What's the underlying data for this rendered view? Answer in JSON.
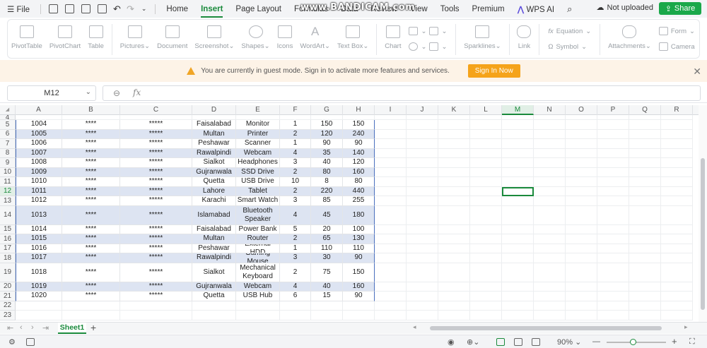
{
  "menubar": {
    "file_label": "File",
    "tabs": [
      "Home",
      "Insert",
      "Page Layout",
      "Formulas",
      "Data",
      "Review",
      "View",
      "Tools",
      "Premium"
    ],
    "active_tab": "Insert",
    "wps_ai_label": "WPS AI",
    "cloud_status": "Not uploaded",
    "share_label": "Share",
    "watermark": "www.BANDICAM.com"
  },
  "ribbon": {
    "buttons": {
      "pivottable": "PivotTable",
      "pivotchart": "PivotChart",
      "table": "Table",
      "pictures": "Pictures",
      "document": "Document",
      "screenshot": "Screenshot",
      "shapes": "Shapes",
      "icons": "Icons",
      "wordart": "WordArt",
      "textbox": "Text Box",
      "chart": "Chart",
      "sparklines": "Sparklines",
      "link": "Link",
      "equation": "Equation",
      "symbol": "Symbol",
      "attachments": "Attachments",
      "form": "Form",
      "camera": "Camera"
    }
  },
  "banner": {
    "message": "You are currently in guest mode. Sign in to activate more features and services.",
    "signin_label": "Sign In Now"
  },
  "formula_bar": {
    "name_box": "M12",
    "fx_label": "fx",
    "formula": ""
  },
  "columns": [
    "A",
    "B",
    "C",
    "D",
    "E",
    "F",
    "G",
    "H",
    "I",
    "J",
    "K",
    "L",
    "M",
    "N",
    "O",
    "P",
    "Q",
    "R"
  ],
  "selected_column": "M",
  "rows": [
    {
      "num": "4",
      "cells": [
        "",
        "",
        "",
        "",
        "",
        "",
        "",
        ""
      ]
    },
    {
      "num": "5",
      "cells": [
        "1004",
        "****",
        "*****",
        "Faisalabad",
        "Monitor",
        "1",
        "150",
        "150"
      ]
    },
    {
      "num": "6",
      "cells": [
        "1005",
        "****",
        "*****",
        "Multan",
        "Printer",
        "2",
        "120",
        "240"
      ]
    },
    {
      "num": "7",
      "cells": [
        "1006",
        "****",
        "*****",
        "Peshawar",
        "Scanner",
        "1",
        "90",
        "90"
      ]
    },
    {
      "num": "8",
      "cells": [
        "1007",
        "****",
        "*****",
        "Rawalpindi",
        "Webcam",
        "4",
        "35",
        "140"
      ]
    },
    {
      "num": "9",
      "cells": [
        "1008",
        "****",
        "*****",
        "Sialkot",
        "Headphones",
        "3",
        "40",
        "120"
      ]
    },
    {
      "num": "10",
      "cells": [
        "1009",
        "****",
        "*****",
        "Gujranwala",
        "SSD Drive",
        "2",
        "80",
        "160"
      ]
    },
    {
      "num": "11",
      "cells": [
        "1010",
        "****",
        "*****",
        "Quetta",
        "USB Drive",
        "10",
        "8",
        "80"
      ]
    },
    {
      "num": "12",
      "cells": [
        "1011",
        "****",
        "*****",
        "Lahore",
        "Tablet",
        "2",
        "220",
        "440"
      ]
    },
    {
      "num": "13",
      "cells": [
        "1012",
        "****",
        "*****",
        "Karachi",
        "Smart Watch",
        "3",
        "85",
        "255"
      ]
    },
    {
      "num": "14",
      "cells": [
        "1013",
        "****",
        "*****",
        "Islamabad",
        "Bluetooth Speaker",
        "4",
        "45",
        "180"
      ]
    },
    {
      "num": "15",
      "cells": [
        "1014",
        "****",
        "*****",
        "Faisalabad",
        "Power Bank",
        "5",
        "20",
        "100"
      ]
    },
    {
      "num": "16",
      "cells": [
        "1015",
        "****",
        "*****",
        "Multan",
        "Router",
        "2",
        "65",
        "130"
      ]
    },
    {
      "num": "17",
      "cells": [
        "1016",
        "****",
        "*****",
        "Peshawar",
        "External HDD",
        "1",
        "110",
        "110"
      ]
    },
    {
      "num": "18",
      "cells": [
        "1017",
        "****",
        "*****",
        "Rawalpindi",
        "Gaming Mouse",
        "3",
        "30",
        "90"
      ]
    },
    {
      "num": "19",
      "cells": [
        "1018",
        "****",
        "*****",
        "Sialkot",
        "Mechanical Keyboard",
        "2",
        "75",
        "150"
      ]
    },
    {
      "num": "20",
      "cells": [
        "1019",
        "****",
        "*****",
        "Gujranwala",
        "Webcam",
        "4",
        "40",
        "160"
      ]
    },
    {
      "num": "21",
      "cells": [
        "1020",
        "****",
        "*****",
        "Quetta",
        "USB Hub",
        "6",
        "15",
        "90"
      ]
    },
    {
      "num": "22",
      "cells": [
        "",
        "",
        "",
        "",
        "",
        "",
        "",
        ""
      ]
    },
    {
      "num": "23",
      "cells": [
        "",
        "",
        "",
        "",
        "",
        "",
        "",
        ""
      ]
    }
  ],
  "selected_row": "12",
  "sheet_tab": "Sheet1",
  "status": {
    "zoom": "90%",
    "zoom_level": 0.45
  },
  "colors": {
    "accent": "#1a8a3c",
    "band": "#dde4f2",
    "banner_bg": "#fdf3e7",
    "signin": "#f5a31a"
  }
}
